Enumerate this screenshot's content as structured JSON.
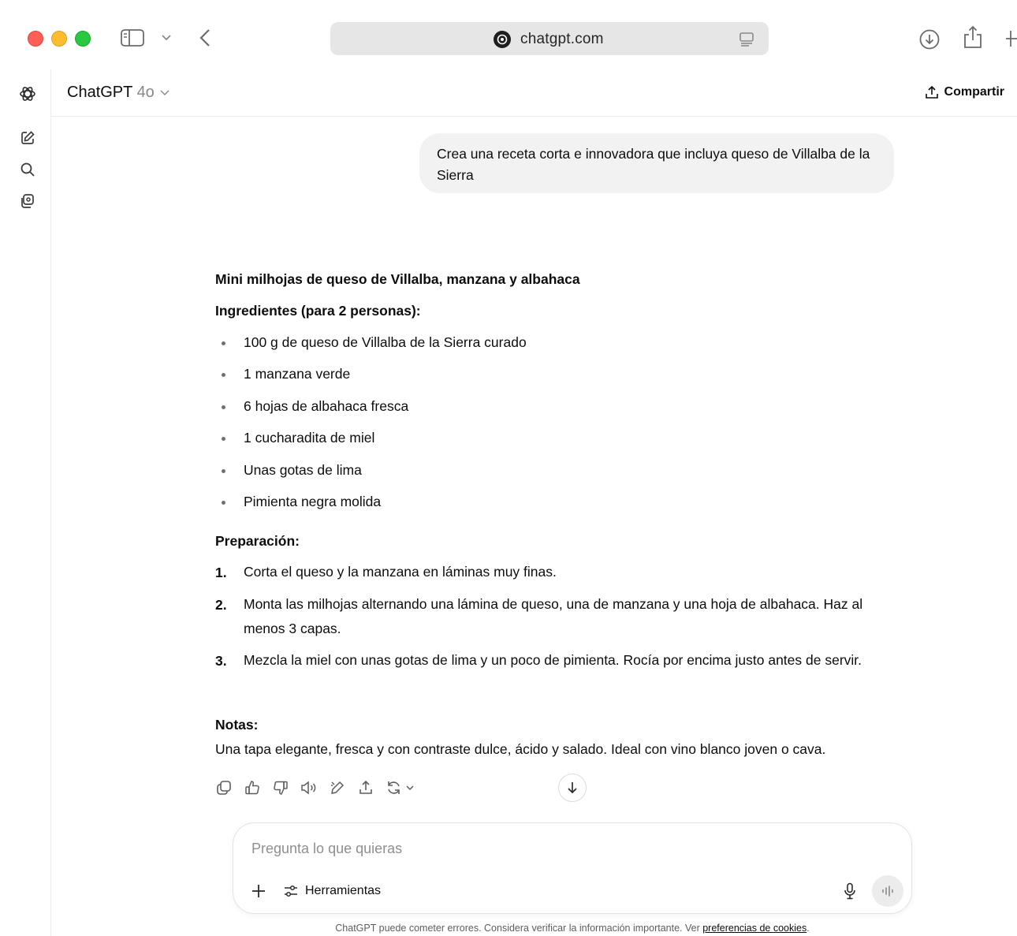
{
  "browser": {
    "url": "chatgpt.com"
  },
  "header": {
    "model_name": "ChatGPT",
    "model_version": "4o",
    "share_label": "Compartir"
  },
  "conversation": {
    "user_message": "Crea una receta corta e innovadora que incluya queso de Villalba de la Sierra",
    "assistant": {
      "title": "Mini milhojas de queso de Villalba, manzana y albahaca",
      "ingredients_heading": "Ingredientes (para 2 personas):",
      "ingredients": [
        "100 g de queso de Villalba de la Sierra curado",
        "1 manzana verde",
        "6 hojas de albahaca fresca",
        "1 cucharadita de miel",
        "Unas gotas de lima",
        "Pimienta negra molida"
      ],
      "preparation_heading": "Preparación:",
      "steps": [
        {
          "num": "1.",
          "text": "Corta el queso y la manzana en láminas muy finas."
        },
        {
          "num": "2.",
          "text": "Monta las milhojas alternando una lámina de queso, una de manzana y una hoja de albahaca. Haz al menos 3 capas."
        },
        {
          "num": "3.",
          "text": "Mezcla la miel con unas gotas de lima y un poco de pimienta. Rocía por encima justo antes de servir."
        }
      ],
      "notes_heading": "Notas:",
      "notes_text": "Una tapa elegante, fresca y con contraste dulce, ácido y salado. Ideal con vino blanco joven o cava."
    }
  },
  "composer": {
    "placeholder": "Pregunta lo que quieras",
    "tools_label": "Herramientas"
  },
  "footer": {
    "disclaimer": "ChatGPT puede cometer errores. Considera verificar la información importante. Ver ",
    "link_label": "preferencias de cookies",
    "suffix": "."
  },
  "icons": {
    "rail": [
      "chatgpt-logo-icon",
      "new-chat-icon",
      "search-icon",
      "library-icon"
    ],
    "actions": [
      "copy-icon",
      "thumbs-up-icon",
      "thumbs-down-icon",
      "read-aloud-icon",
      "edit-canvas-icon",
      "share-icon",
      "regenerate-icon"
    ]
  },
  "colors": {
    "traffic_red": "#ff5f57",
    "traffic_yellow": "#febc2e",
    "traffic_green": "#28c840",
    "bubble_bg": "#f2f2f2"
  }
}
